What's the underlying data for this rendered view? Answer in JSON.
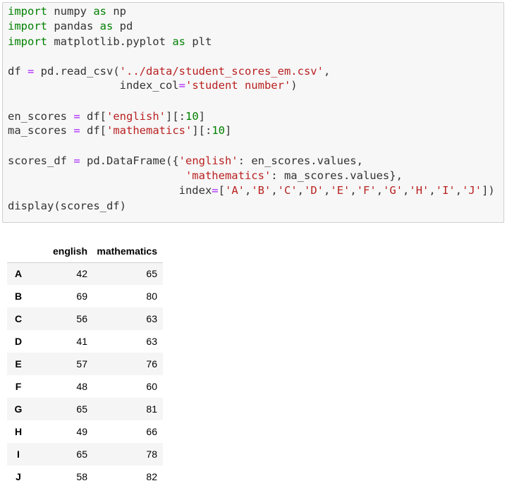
{
  "code_cell": {
    "lines": [
      [
        {
          "t": "import",
          "c": "kw"
        },
        {
          "t": " numpy ",
          "c": "plain"
        },
        {
          "t": "as",
          "c": "kw"
        },
        {
          "t": " np",
          "c": "plain"
        }
      ],
      [
        {
          "t": "import",
          "c": "kw"
        },
        {
          "t": " pandas ",
          "c": "plain"
        },
        {
          "t": "as",
          "c": "kw"
        },
        {
          "t": " pd",
          "c": "plain"
        }
      ],
      [
        {
          "t": "import",
          "c": "kw"
        },
        {
          "t": " matplotlib.pyplot ",
          "c": "plain"
        },
        {
          "t": "as",
          "c": "kw"
        },
        {
          "t": " plt",
          "c": "plain"
        }
      ],
      [],
      [
        {
          "t": "df ",
          "c": "plain"
        },
        {
          "t": "=",
          "c": "op"
        },
        {
          "t": " pd.read_csv(",
          "c": "plain"
        },
        {
          "t": "'../data/student_scores_em.csv'",
          "c": "str"
        },
        {
          "t": ",",
          "c": "plain"
        }
      ],
      [
        {
          "t": "                 index_col",
          "c": "plain"
        },
        {
          "t": "=",
          "c": "op"
        },
        {
          "t": "'student number'",
          "c": "str"
        },
        {
          "t": ")",
          "c": "plain"
        }
      ],
      [],
      [
        {
          "t": "en_scores ",
          "c": "plain"
        },
        {
          "t": "=",
          "c": "op"
        },
        {
          "t": " df[",
          "c": "plain"
        },
        {
          "t": "'english'",
          "c": "str"
        },
        {
          "t": "][:",
          "c": "plain"
        },
        {
          "t": "10",
          "c": "num"
        },
        {
          "t": "]",
          "c": "plain"
        }
      ],
      [
        {
          "t": "ma_scores ",
          "c": "plain"
        },
        {
          "t": "=",
          "c": "op"
        },
        {
          "t": " df[",
          "c": "plain"
        },
        {
          "t": "'mathematics'",
          "c": "str"
        },
        {
          "t": "][:",
          "c": "plain"
        },
        {
          "t": "10",
          "c": "num"
        },
        {
          "t": "]",
          "c": "plain"
        }
      ],
      [],
      [
        {
          "t": "scores_df ",
          "c": "plain"
        },
        {
          "t": "=",
          "c": "op"
        },
        {
          "t": " pd.DataFrame({",
          "c": "plain"
        },
        {
          "t": "'english'",
          "c": "str"
        },
        {
          "t": ": en_scores.values,",
          "c": "plain"
        }
      ],
      [
        {
          "t": "                           ",
          "c": "plain"
        },
        {
          "t": "'mathematics'",
          "c": "str"
        },
        {
          "t": ": ma_scores.values},",
          "c": "plain"
        }
      ],
      [
        {
          "t": "                          index",
          "c": "plain"
        },
        {
          "t": "=",
          "c": "op"
        },
        {
          "t": "[",
          "c": "plain"
        },
        {
          "t": "'A'",
          "c": "str"
        },
        {
          "t": ",",
          "c": "plain"
        },
        {
          "t": "'B'",
          "c": "str"
        },
        {
          "t": ",",
          "c": "plain"
        },
        {
          "t": "'C'",
          "c": "str"
        },
        {
          "t": ",",
          "c": "plain"
        },
        {
          "t": "'D'",
          "c": "str"
        },
        {
          "t": ",",
          "c": "plain"
        },
        {
          "t": "'E'",
          "c": "str"
        },
        {
          "t": ",",
          "c": "plain"
        },
        {
          "t": "'F'",
          "c": "str"
        },
        {
          "t": ",",
          "c": "plain"
        },
        {
          "t": "'G'",
          "c": "str"
        },
        {
          "t": ",",
          "c": "plain"
        },
        {
          "t": "'H'",
          "c": "str"
        },
        {
          "t": ",",
          "c": "plain"
        },
        {
          "t": "'I'",
          "c": "str"
        },
        {
          "t": ",",
          "c": "plain"
        },
        {
          "t": "'J'",
          "c": "str"
        },
        {
          "t": "])",
          "c": "plain"
        }
      ],
      [
        {
          "t": "display(scores_df)",
          "c": "plain"
        }
      ]
    ]
  },
  "output_table": {
    "columns": [
      "english",
      "mathematics"
    ],
    "rows": [
      {
        "index": "A",
        "english": "42",
        "mathematics": "65"
      },
      {
        "index": "B",
        "english": "69",
        "mathematics": "80"
      },
      {
        "index": "C",
        "english": "56",
        "mathematics": "63"
      },
      {
        "index": "D",
        "english": "41",
        "mathematics": "63"
      },
      {
        "index": "E",
        "english": "57",
        "mathematics": "76"
      },
      {
        "index": "F",
        "english": "48",
        "mathematics": "60"
      },
      {
        "index": "G",
        "english": "65",
        "mathematics": "81"
      },
      {
        "index": "H",
        "english": "49",
        "mathematics": "66"
      },
      {
        "index": "I",
        "english": "65",
        "mathematics": "78"
      },
      {
        "index": "J",
        "english": "58",
        "mathematics": "82"
      }
    ]
  },
  "colors": {
    "keyword": "#008000",
    "string": "#ba2121",
    "operator": "#aa22ff",
    "number": "#008000",
    "code_background": "#f7f7f7",
    "striped_row": "#f5f5f5"
  }
}
